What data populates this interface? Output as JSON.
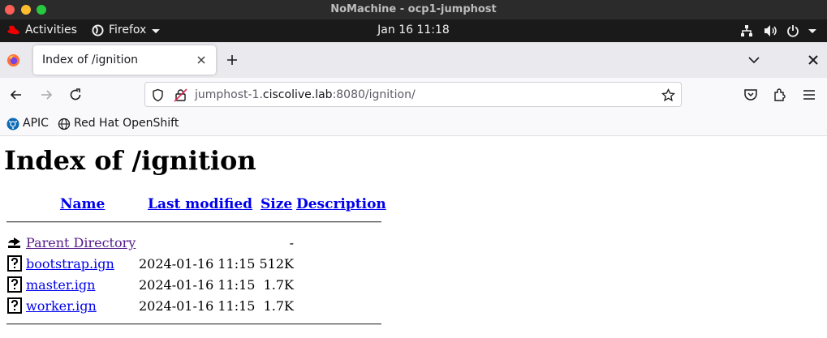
{
  "window": {
    "title": "NoMachine - ocp1-jumphost"
  },
  "gnome": {
    "activities": "Activities",
    "app_menu": "Firefox",
    "clock": "Jan 16  11:18"
  },
  "tab": {
    "title": "Index of /ignition"
  },
  "urlbar": {
    "host_prefix": "jumphost-1.",
    "host_domain": "ciscolive.lab",
    "rest": ":8080/ignition/"
  },
  "bookmarks": [
    {
      "label": "APIC"
    },
    {
      "label": "Red Hat OpenShift"
    }
  ],
  "page": {
    "heading": "Index of /ignition",
    "columns": {
      "name": "Name",
      "modified": "Last modified",
      "size": "Size",
      "description": "Description"
    },
    "parent": {
      "name": "Parent Directory",
      "size": "-"
    },
    "files": [
      {
        "name": "bootstrap.ign",
        "modified": "2024-01-16 11:15",
        "size": "512K"
      },
      {
        "name": "master.ign",
        "modified": "2024-01-16 11:15",
        "size": "1.7K"
      },
      {
        "name": "worker.ign",
        "modified": "2024-01-16 11:15",
        "size": "1.7K"
      }
    ]
  },
  "colors": {
    "link": "#0000ee",
    "visited": "#551a8b",
    "gnome_bar": "#1a1a1a",
    "redhat": "#ee0000"
  }
}
